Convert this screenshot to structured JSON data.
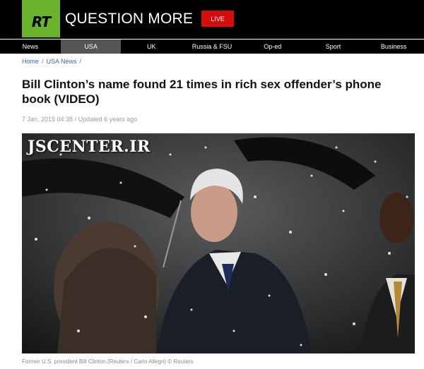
{
  "header": {
    "logo_text": "RT",
    "tagline": "QUESTION MORE",
    "live_label": "LIVE"
  },
  "nav": {
    "items": [
      {
        "label": "News"
      },
      {
        "label": "USA",
        "active": true
      },
      {
        "label": "UK"
      },
      {
        "label": "Russia & FSU"
      },
      {
        "label": "Op-ed"
      },
      {
        "label": "Sport"
      },
      {
        "label": "Business"
      }
    ]
  },
  "breadcrumb": {
    "home": "Home",
    "sep1": "/",
    "section": "USA News",
    "sep2": "/"
  },
  "article": {
    "title": "Bill Clinton’s name found 21 times in rich sex offender’s phone book (VIDEO)",
    "meta": "7 Jan, 2015 04:38 / Updated 6 years ago",
    "watermark": "JSCENTER.IR",
    "caption": "Former U.S. president Bill Clinton.(Reuters / Carlo Allegri) © Reuters"
  },
  "colors": {
    "brand_green": "#6ab42c",
    "live_red": "#d40e0e",
    "nav_active": "#555555",
    "link_blue": "#3a6aa8"
  }
}
